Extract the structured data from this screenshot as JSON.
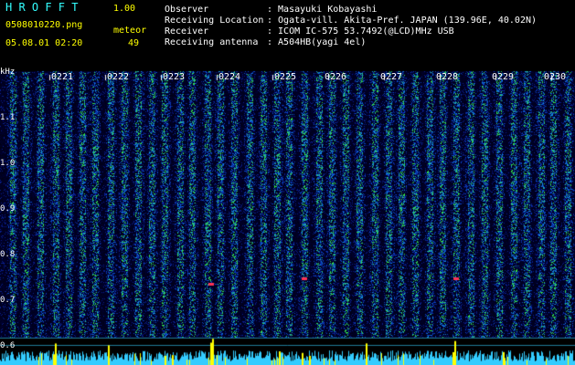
{
  "app": {
    "name": "H R O F F T",
    "version": "1.00"
  },
  "file": {
    "name": "0508010220.png",
    "datetime": "05.08.01 02:20"
  },
  "counter": {
    "label": "meteor",
    "value": "49"
  },
  "info": {
    "keys": [
      "Observer",
      "Receiving Location",
      "Receiver",
      "Receiving antenna"
    ],
    "values": [
      ": Masayuki Kobayashi",
      ": Ogata-vill. Akita-Pref. JAPAN (139.96E, 40.02N)",
      ": ICOM IC-575 53.7492(@LCD)MHz USB",
      ": A504HB(yagi 4el)"
    ]
  },
  "axis": {
    "y_unit": "kHz",
    "y_ticks": [
      "1.1",
      "1.0",
      "0.9",
      "0.8",
      "0.7",
      "0.6"
    ],
    "x_ticks": [
      "0221",
      "0222",
      "0223",
      "0224",
      "0225",
      "0226",
      "0227",
      "0228",
      "0229",
      "0230"
    ]
  },
  "colors": {
    "background": "#000000",
    "header_cyan": "#33ffff",
    "header_yellow": "#ffff00",
    "signal_low": "#0a1a8a",
    "signal_high": "#33dd33",
    "level_bars": "#ffff00",
    "noise_band": "#33ccff"
  }
}
